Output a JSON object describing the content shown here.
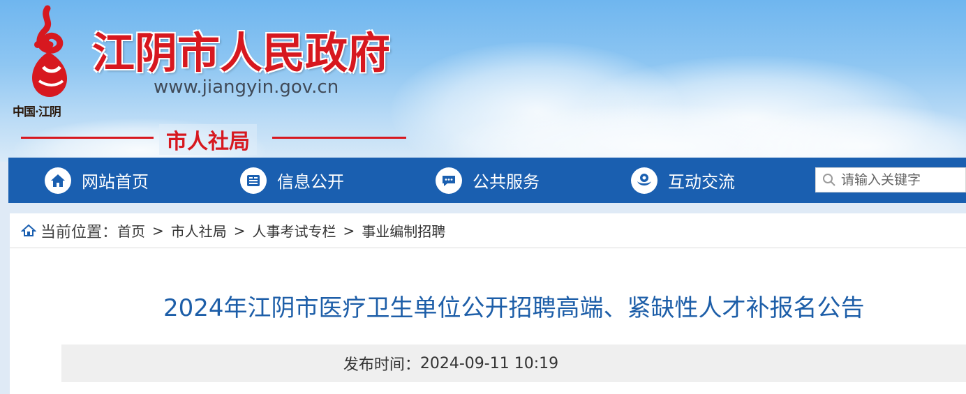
{
  "header": {
    "logo_caption": "中国·江阴",
    "site_title": "江阴市人民政府",
    "site_url": "www.jiangyin.gov.cn",
    "department": "市人社局"
  },
  "nav": {
    "items": [
      {
        "label": "网站首页",
        "icon": "home-icon"
      },
      {
        "label": "信息公开",
        "icon": "document-list-icon"
      },
      {
        "label": "公共服务",
        "icon": "chat-bubble-icon"
      },
      {
        "label": "互动交流",
        "icon": "interaction-icon"
      }
    ],
    "search_placeholder": "请输入关键字"
  },
  "breadcrumb": {
    "prefix": "当前位置：",
    "items": [
      "首页",
      "市人社局",
      "人事考试专栏",
      "事业编制招聘"
    ],
    "separator": ">"
  },
  "article": {
    "title": "2024年江阴市医疗卫生单位公开招聘高端、紧缺性人才补报名公告",
    "publish_label": "发布时间：",
    "publish_time": "2024-09-11 10:19"
  },
  "colors": {
    "brand_red": "#d7181f",
    "nav_blue": "#1a5fb0",
    "title_blue": "#1d5ea8"
  }
}
